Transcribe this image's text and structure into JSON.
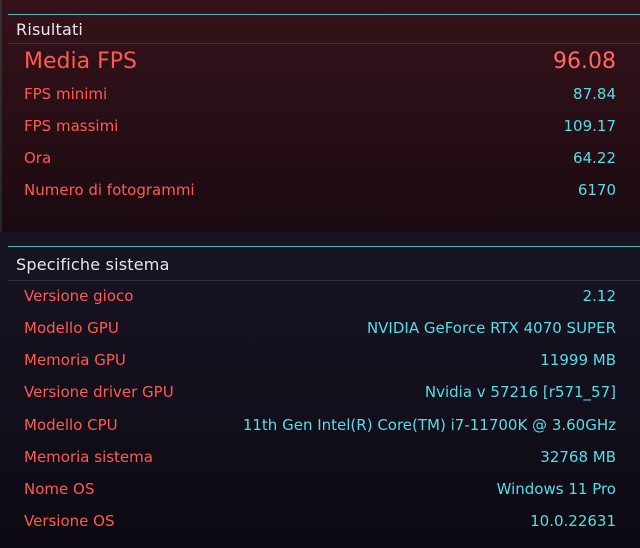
{
  "results": {
    "title": "Risultati",
    "main": {
      "label": "Media FPS",
      "value": "96.08"
    },
    "rows": [
      {
        "label": "FPS minimi",
        "value": "87.84"
      },
      {
        "label": "FPS massimi",
        "value": "109.17"
      },
      {
        "label": "Ora",
        "value": "64.22"
      },
      {
        "label": "Numero di fotogrammi",
        "value": "6170"
      }
    ]
  },
  "specs": {
    "title": "Specifiche sistema",
    "rows": [
      {
        "label": "Versione gioco",
        "value": "2.12"
      },
      {
        "label": "Modello GPU",
        "value": "NVIDIA GeForce RTX 4070 SUPER"
      },
      {
        "label": "Memoria GPU",
        "value": "11999 MB"
      },
      {
        "label": "Versione driver GPU",
        "value": "Nvidia v 57216 [r571_57]"
      },
      {
        "label": "Modello CPU",
        "value": "11th Gen Intel(R) Core(TM) i7-11700K @ 3.60GHz"
      },
      {
        "label": "Memoria sistema",
        "value": "32768 MB"
      },
      {
        "label": "Nome OS",
        "value": "Windows 11 Pro"
      },
      {
        "label": "Versione OS",
        "value": "10.0.22631"
      }
    ]
  },
  "colors": {
    "label": "#ff5a50",
    "value": "#56dde8",
    "accent_line": "#57d3d9",
    "results_bg": "#2a0f16",
    "specs_bg": "#120e1a"
  }
}
